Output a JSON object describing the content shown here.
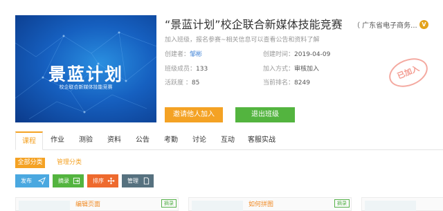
{
  "cover": {
    "title": "景蓝计划",
    "subtitle": "校企联合新媒体技能竞赛"
  },
  "header": {
    "title": "“景蓝计划”校企联合新媒体技能竞赛",
    "org": "（ 广东省电子商务...",
    "verified_icon": "V",
    "desc": "加入班级，报名参赛~相关信息可以查看公告和资料了解",
    "stamp": "已加入"
  },
  "info": {
    "creator_label": "创建者：",
    "creator": "邹彬",
    "created_label": "创建时间：",
    "created": "2019-04-09",
    "members_label": "班级成员：",
    "members": "133",
    "join_label": "加入方式：",
    "join": "审核加入",
    "activity_label": "活跃度 ：",
    "activity": "85",
    "rank_label": "当前排名：",
    "rank": "8249"
  },
  "buttons": {
    "invite": "邀请他人加入",
    "quit": "退出班级"
  },
  "tabs": [
    "课程",
    "作业",
    "测验",
    "资料",
    "公告",
    "考勤",
    "讨论",
    "互动",
    "客服实战"
  ],
  "categories": {
    "all": "全部分类",
    "manage": "管理分类"
  },
  "toolbar": {
    "post": "发布",
    "pick": "摘录",
    "sort": "排序",
    "mgmt": "管理"
  },
  "cards": [
    {
      "name": "编辑页面",
      "tag": "摘录"
    },
    {
      "name": "如何拼图",
      "tag": "摘录"
    }
  ],
  "colors": {
    "accent": "#f4a224",
    "green": "#53b43f",
    "blue": "#4aa8e0",
    "orange": "#ee6a2e",
    "slate": "#56717f"
  }
}
